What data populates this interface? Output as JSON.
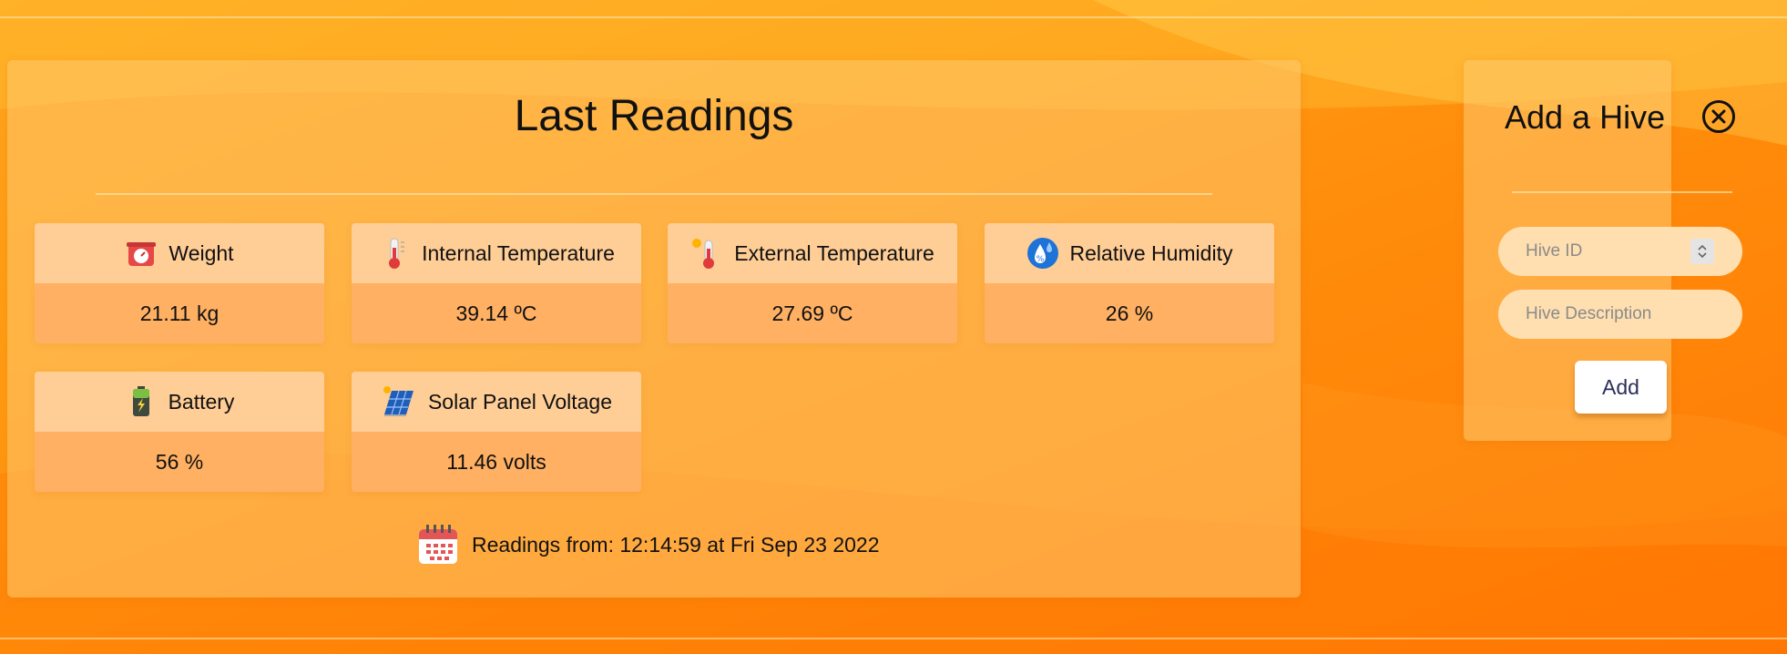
{
  "readings": {
    "title": "Last Readings",
    "cards": [
      {
        "label": "Weight",
        "value": "21.11 kg",
        "icon": "scale-icon"
      },
      {
        "label": "Internal Temperature",
        "value": "39.14 ºC",
        "icon": "thermometer-icon"
      },
      {
        "label": "External Temperature",
        "value": "27.69 ºC",
        "icon": "sun-thermometer-icon"
      },
      {
        "label": "Relative Humidity",
        "value": "26 %",
        "icon": "humidity-icon"
      },
      {
        "label": "Battery",
        "value": "56 %",
        "icon": "battery-icon"
      },
      {
        "label": "Solar Panel Voltage",
        "value": "11.46 volts",
        "icon": "solar-panel-icon"
      }
    ],
    "timestamp": "Readings from: 12:14:59 at Fri Sep 23 2022"
  },
  "hive_form": {
    "title": "Add a Hive",
    "hive_id_placeholder": "Hive ID",
    "hive_description_placeholder": "Hive Description",
    "add_label": "Add"
  },
  "colors": {
    "background": "#ff9a12",
    "card_header": "#ffcd96",
    "card_body": "#ffb062",
    "add_text": "#2a2f5a"
  }
}
